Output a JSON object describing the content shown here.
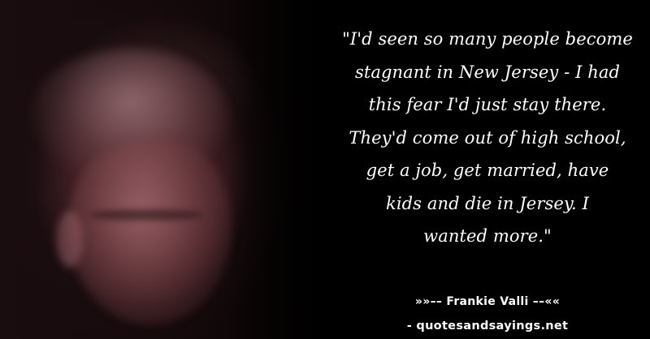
{
  "quote": {
    "lines": [
      "\"I'd seen so many people become",
      "stagnant in New Jersey - I had",
      "this fear I'd just stay there.",
      "They'd come out of high school,",
      "get a job, get married, have",
      "kids and die in Jersey. I",
      "wanted more.\""
    ]
  },
  "attribution": {
    "author": "»»–– Frankie Valli ––««",
    "site": "- quotesandsayings.net"
  },
  "colors": {
    "background": "#000000",
    "text": "#ffffff"
  }
}
